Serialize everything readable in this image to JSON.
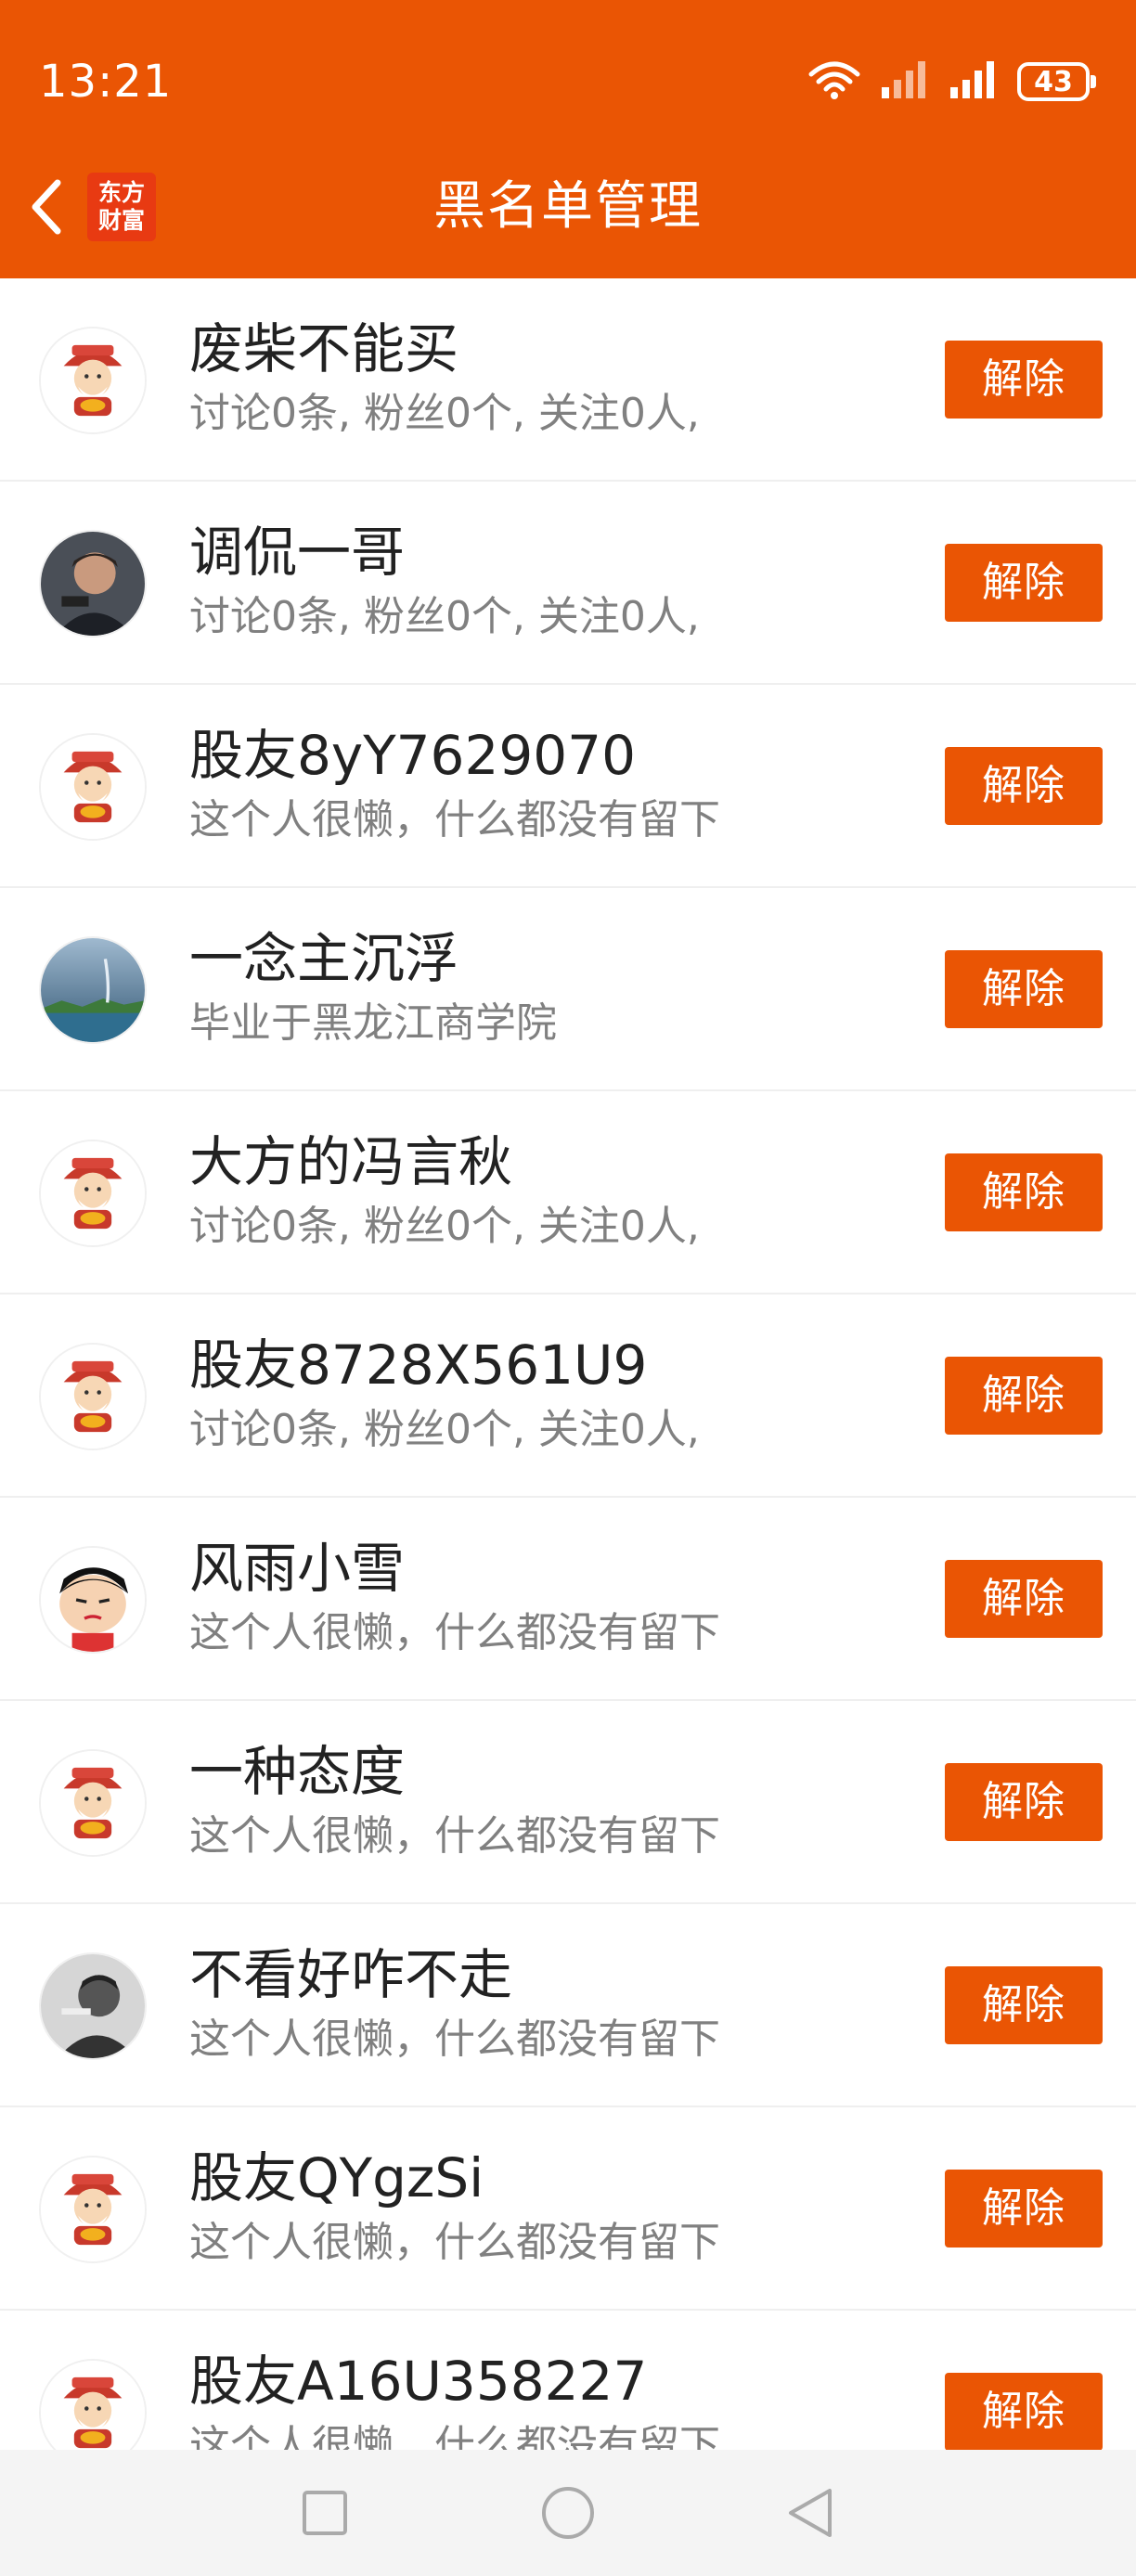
{
  "status_bar": {
    "time": "13:21",
    "battery": "43"
  },
  "header": {
    "title": "黑名单管理",
    "logo_line1": "东方",
    "logo_line2": "财富"
  },
  "unblock_label": "解除",
  "users": [
    {
      "name": "废柴不能买",
      "desc": "讨论0条, 粉丝0个, 关注0人,",
      "avatar": "default-avatar"
    },
    {
      "name": "调侃一哥",
      "desc": "讨论0条, 粉丝0个, 关注0人,",
      "avatar": "man-photo-avatar"
    },
    {
      "name": "股友8yY7629070",
      "desc": "这个人很懒，什么都没有留下",
      "avatar": "default-avatar"
    },
    {
      "name": "一念主沉浮",
      "desc": "毕业于黑龙江商学院",
      "avatar": "landscape-avatar"
    },
    {
      "name": "大方的冯言秋",
      "desc": "讨论0条, 粉丝0个, 关注0人,",
      "avatar": "default-avatar"
    },
    {
      "name": "股友8728X561U9",
      "desc": "讨论0条, 粉丝0个, 关注0人,",
      "avatar": "default-avatar"
    },
    {
      "name": "风雨小雪",
      "desc": "这个人很懒，什么都没有留下",
      "avatar": "cartoon-avatar"
    },
    {
      "name": "一种态度",
      "desc": "这个人很懒，什么都没有留下",
      "avatar": "default-avatar"
    },
    {
      "name": "不看好咋不走",
      "desc": "这个人很懒，什么都没有留下",
      "avatar": "bw-photo-avatar"
    },
    {
      "name": "股友QYgzSi",
      "desc": "这个人很懒，什么都没有留下",
      "avatar": "default-avatar"
    },
    {
      "name": "股友A16U358227",
      "desc": "这个人很懒，什么都没有留下",
      "avatar": "default-avatar"
    }
  ],
  "colors": {
    "brand": "#ea5504",
    "text": "#222222",
    "subtext": "#808080"
  }
}
